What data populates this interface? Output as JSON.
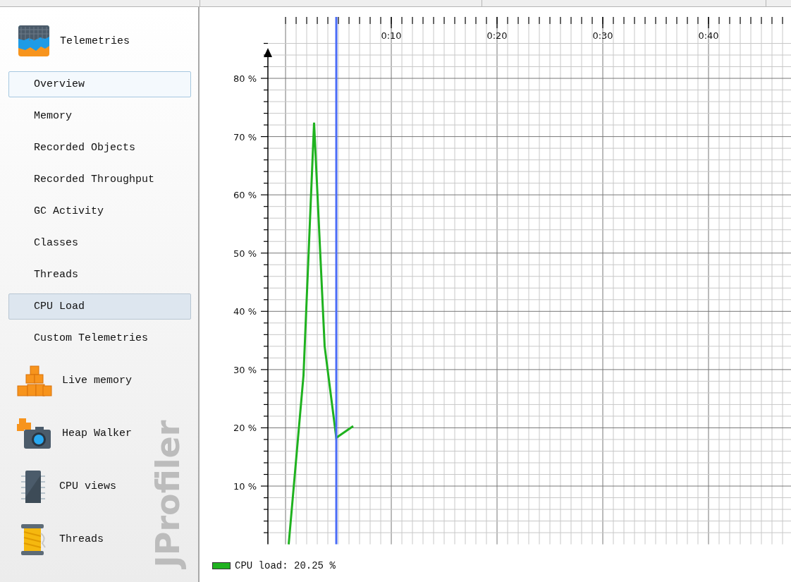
{
  "sidebar": {
    "watermark": "JProfiler",
    "sections": [
      {
        "label": "Telemetries",
        "kind": "telemetry",
        "children": [
          {
            "label": "Overview",
            "selected": false,
            "hovered": true
          },
          {
            "label": "Memory",
            "selected": false,
            "hovered": false
          },
          {
            "label": "Recorded Objects",
            "selected": false,
            "hovered": false
          },
          {
            "label": "Recorded Throughput",
            "selected": false,
            "hovered": false
          },
          {
            "label": "GC Activity",
            "selected": false,
            "hovered": false
          },
          {
            "label": "Classes",
            "selected": false,
            "hovered": false
          },
          {
            "label": "Threads",
            "selected": false,
            "hovered": false
          },
          {
            "label": "CPU Load",
            "selected": true,
            "hovered": false
          },
          {
            "label": "Custom Telemetries",
            "selected": false,
            "hovered": false
          }
        ]
      },
      {
        "label": "Live memory",
        "kind": "blocks"
      },
      {
        "label": "Heap Walker",
        "kind": "camera"
      },
      {
        "label": "CPU views",
        "kind": "chip"
      },
      {
        "label": "Threads",
        "kind": "spool"
      }
    ]
  },
  "chart": {
    "chart_data": {
      "type": "line",
      "xlim": [
        -1.67,
        47.8
      ],
      "ylim": [
        0,
        86
      ],
      "xticks": [
        {
          "value": 10,
          "label": "0:10"
        },
        {
          "value": 20,
          "label": "0:20"
        },
        {
          "value": 30,
          "label": "0:30"
        },
        {
          "value": 40,
          "label": "0:40"
        }
      ],
      "yticks": [
        {
          "value": 10,
          "label": "10 %"
        },
        {
          "value": 20,
          "label": "20 %"
        },
        {
          "value": 30,
          "label": "30 %"
        },
        {
          "value": 40,
          "label": "40 %"
        },
        {
          "value": 50,
          "label": "50 %"
        },
        {
          "value": 60,
          "label": "60 %"
        },
        {
          "value": 70,
          "label": "70 %"
        },
        {
          "value": 80,
          "label": "80 %"
        }
      ],
      "x": [
        0.3,
        1.7,
        2.7,
        3.7,
        4.8,
        6.4
      ],
      "series": [
        {
          "color": "#1fb21f",
          "values": [
            0,
            29,
            72.4,
            34,
            18.3,
            20.3
          ]
        }
      ],
      "grid": true,
      "ref_lines": [
        {
          "axis": "x",
          "value": 4.8
        }
      ]
    },
    "legend": {
      "label": "CPU load: 20.25 %"
    }
  }
}
